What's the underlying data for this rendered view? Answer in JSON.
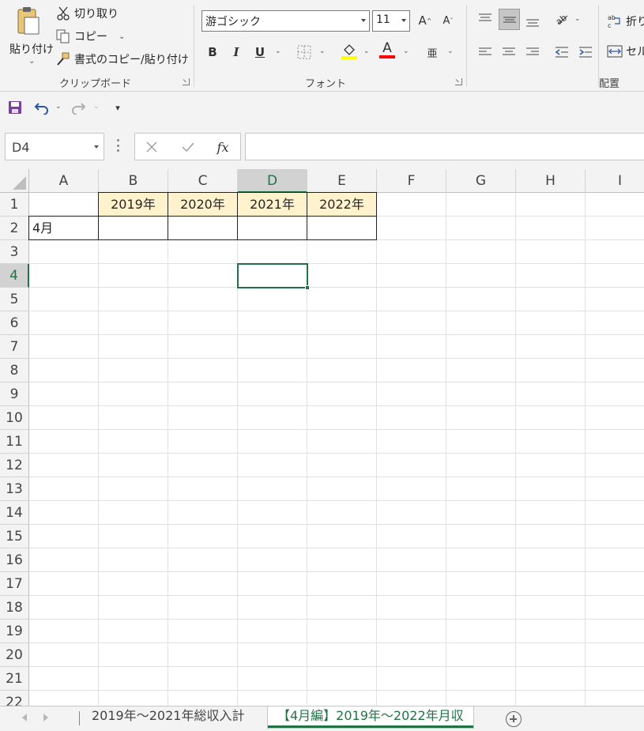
{
  "ribbon": {
    "clipboard": {
      "paste_label": "貼り付け",
      "cut_label": "切り取り",
      "copy_label": "コピー",
      "format_painter_label": "書式のコピー/貼り付け",
      "group_label": "クリップボード"
    },
    "font": {
      "font_name": "游ゴシック",
      "font_size": "11",
      "bold": "B",
      "italic": "I",
      "underline": "U",
      "grow": "A",
      "shrink": "A",
      "font_color_letter": "A",
      "fill_color": "#ffff00",
      "font_color": "#ff0000",
      "phonetic": "亜",
      "group_label": "フォント"
    },
    "alignment": {
      "wrap_label": "折り",
      "merge_label": "セル",
      "group_label": "配置"
    }
  },
  "formula_bar": {
    "name_box": "D4",
    "fx": "fx",
    "value": ""
  },
  "grid": {
    "columns": [
      "A",
      "B",
      "C",
      "D",
      "E",
      "F",
      "G",
      "H",
      "I"
    ],
    "selected_column": "D",
    "rows": [
      "1",
      "2",
      "3",
      "4",
      "5",
      "6",
      "7",
      "8",
      "9",
      "10",
      "11",
      "12",
      "13",
      "14",
      "15",
      "16",
      "17",
      "18",
      "19",
      "20",
      "21",
      "22"
    ],
    "selected_row": "4",
    "cells": {
      "B1": "2019年",
      "C1": "2020年",
      "D1": "2021年",
      "E1": "2022年",
      "A2": "4月"
    },
    "header_fill": "#fff2cc",
    "accent": "#217346"
  },
  "sheets": {
    "tabs": [
      "2019年～2021年総収入計",
      "【4月編】2019年～2022年月収"
    ],
    "active_tab": "【4月編】2019年～2022年月収"
  }
}
